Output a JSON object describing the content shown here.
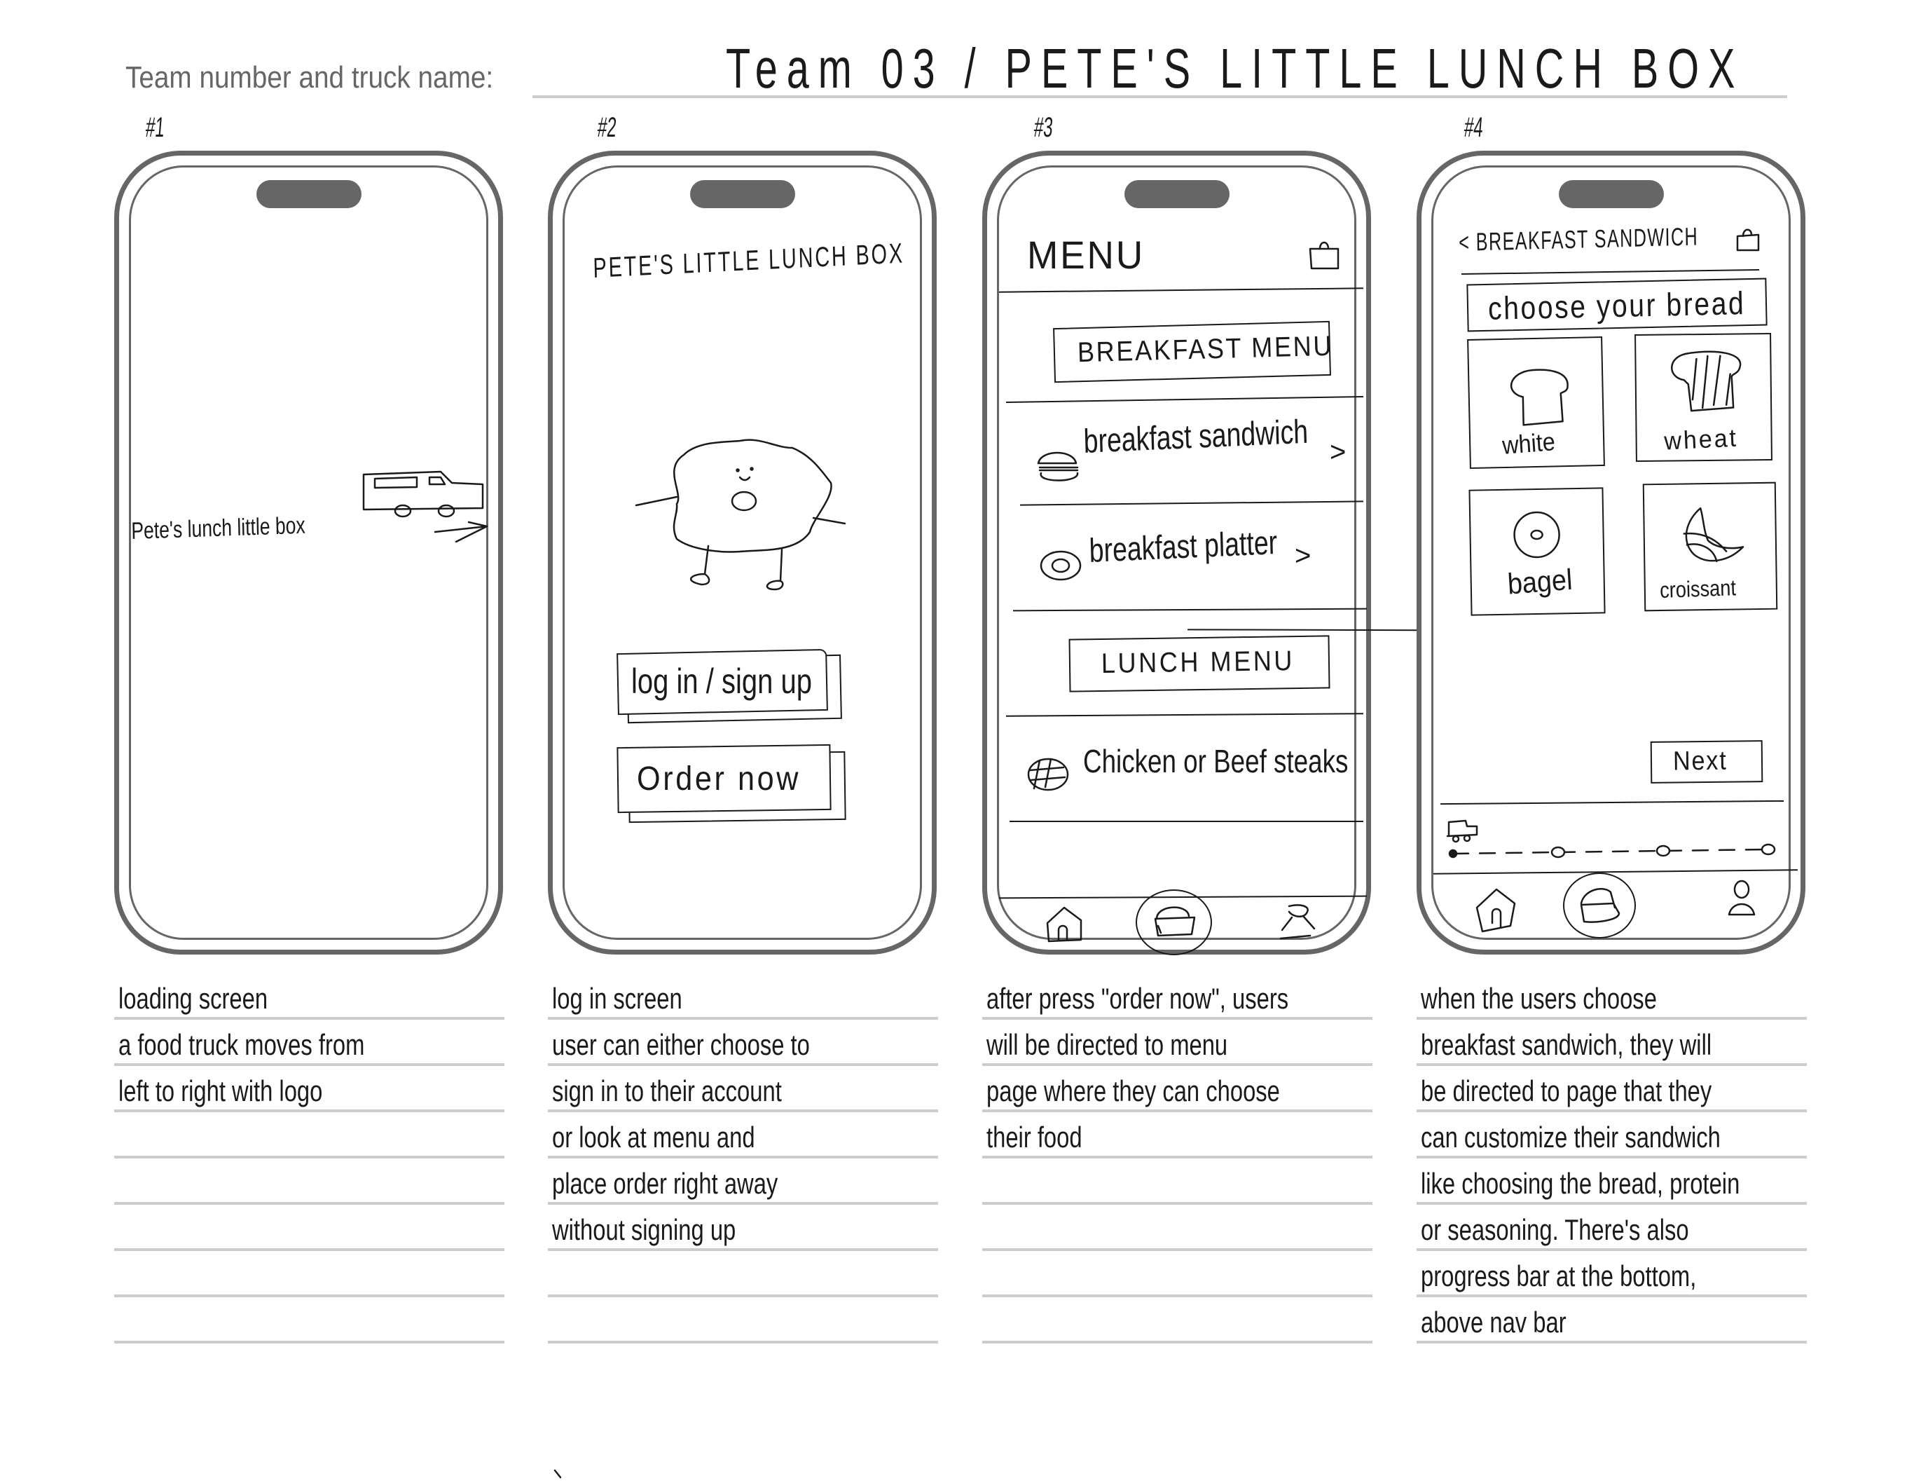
{
  "header": {
    "label": "Team number and truck name:",
    "value": "Team 03 /  PETE'S LITTLE LUNCH BOX"
  },
  "screens": [
    {
      "number": "#1",
      "app": {
        "logo_text": "Pete's lunch little box",
        "animation": "food-truck moving left to right"
      },
      "notes": [
        "   loading  screen",
        "a food  truck  moves  from",
        "left  to  right  with  logo"
      ]
    },
    {
      "number": "#2",
      "app": {
        "title": "PETE'S  LITTLE  LUNCH BOX",
        "buttons": [
          "log in / sign up",
          "Order  now"
        ]
      },
      "notes": [
        "    log  in  screen",
        "user  can  either  choose  to",
        "sign  in  to  their  account",
        "or  look  at  menu  and",
        "place  order  right  away",
        "without  signing  up"
      ]
    },
    {
      "number": "#3",
      "app": {
        "title": "MENU",
        "sections": [
          {
            "heading": "BREAKFAST MENU",
            "items": [
              {
                "icon": "burger-icon",
                "label": "breakfast sandwich",
                "chevron": ">"
              },
              {
                "icon": "platter-icon",
                "label": "breakfast platter",
                "chevron": ">"
              }
            ]
          },
          {
            "heading": "LUNCH MENU",
            "items": [
              {
                "icon": "steak-icon",
                "label": "Chicken or Beef steaks",
                "chevron": ""
              }
            ]
          }
        ],
        "nav": [
          "home",
          "menu",
          "profile"
        ],
        "nav_active": "menu"
      },
      "notes": [
        "after  press  \"order  now\",  users",
        " will  be  directed  to  menu",
        "page  where  they  can  choose",
        " their  food"
      ]
    },
    {
      "number": "#4",
      "app": {
        "back_label": "< BREAKFAST  SANDWICH",
        "step_title": "choose  your  bread",
        "options": [
          {
            "label": "white",
            "icon": "white-bread-icon"
          },
          {
            "label": "wheat",
            "icon": "wheat-bread-icon"
          },
          {
            "label": "bagel",
            "icon": "bagel-icon"
          },
          {
            "label": "croissant",
            "icon": "croissant-icon"
          }
        ],
        "next_label": "Next",
        "progress": {
          "current_step": 1,
          "total_steps": 4
        },
        "nav": [
          "home",
          "menu",
          "profile"
        ],
        "nav_active": "menu"
      },
      "notes": [
        "  when  the  users  choose",
        "breakfast  sandwich,  they  will",
        "be  directed  to  page  that  they",
        "can  customize  their  sandwich",
        "like  choosing  the  bread,  protein",
        " or  seasoning.  There's  also",
        "progress  bar  at  the  bottom,",
        " above  nav  bar"
      ]
    }
  ]
}
